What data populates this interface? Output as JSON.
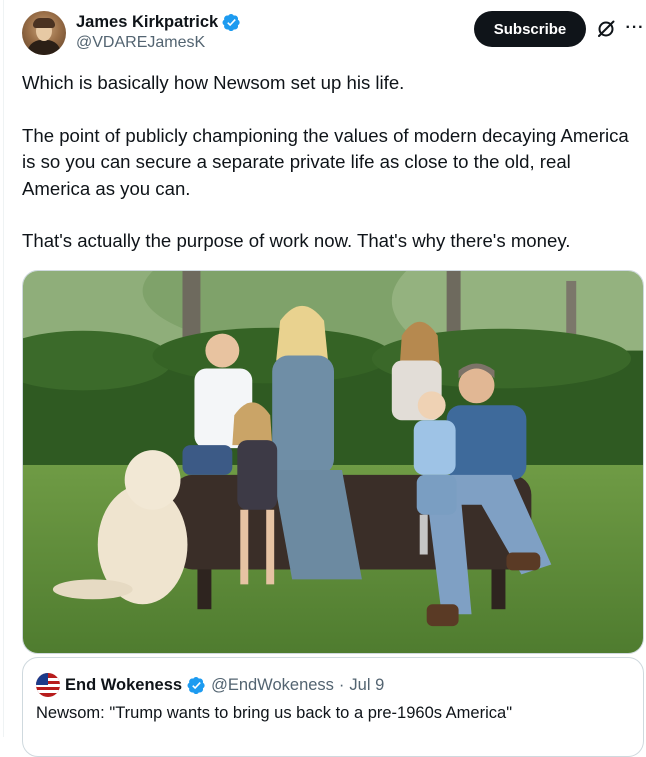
{
  "author": {
    "name": "James Kirkpatrick",
    "handle": "@VDAREJamesK",
    "verified_color": "#1d9bf0"
  },
  "actions": {
    "subscribe_label": "Subscribe",
    "grok_icon": "grok-icon",
    "more_icon": "more-horizontal-icon"
  },
  "tweet": {
    "paragraphs": [
      "Which is basically how Newsom set up his life.",
      "The point of publicly championing the values of modern decaying America is so you can secure a separate private life as close to the old, real America as you can.",
      "That's actually the purpose of work now. That's why there's money."
    ]
  },
  "quote": {
    "name": "End Wokeness",
    "handle": "@EndWokeness",
    "separator": "·",
    "date": "Jul 9",
    "text": "Newsom: \"Trump wants to bring us back to a pre-1960s America\""
  },
  "colors": {
    "text": "#0f1419",
    "secondary": "#536471",
    "border": "#cfd9de",
    "button_bg": "#0f1419"
  }
}
